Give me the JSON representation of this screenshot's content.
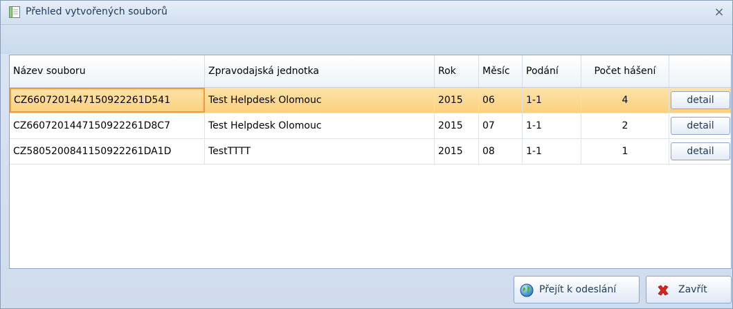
{
  "window": {
    "title": "Přehled vytvořených souborů",
    "close_glyph": "×",
    "icon": "document-list-icon"
  },
  "table": {
    "columns": [
      "Název souboru",
      "Zpravodajská jednotka",
      "Rok",
      "Měsíc",
      "Podání",
      "Počet hášení",
      ""
    ],
    "rows": [
      {
        "file": "CZ6607201447150922261D541",
        "unit": "Test Helpdesk Olomouc",
        "year": "2015",
        "month": "06",
        "submission": "1-1",
        "count": "4",
        "action": "detail",
        "selected": true
      },
      {
        "file": "CZ6607201447150922261D8C7",
        "unit": "Test Helpdesk Olomouc",
        "year": "2015",
        "month": "07",
        "submission": "1-1",
        "count": "2",
        "action": "detail",
        "selected": false
      },
      {
        "file": "CZ5805200841150922261DA1D",
        "unit": "TestTTTT",
        "year": "2015",
        "month": "08",
        "submission": "1-1",
        "count": "1",
        "action": "detail",
        "selected": false
      }
    ]
  },
  "footer": {
    "send_label": "Přejít k odeslání",
    "send_icon": "globe-icon",
    "close_label": "Zavřít",
    "close_icon": "red-x-icon"
  },
  "colors": {
    "selected_row": "#fbd17f",
    "focus_border": "#f09a3a",
    "close_icon": "#d9251d"
  }
}
